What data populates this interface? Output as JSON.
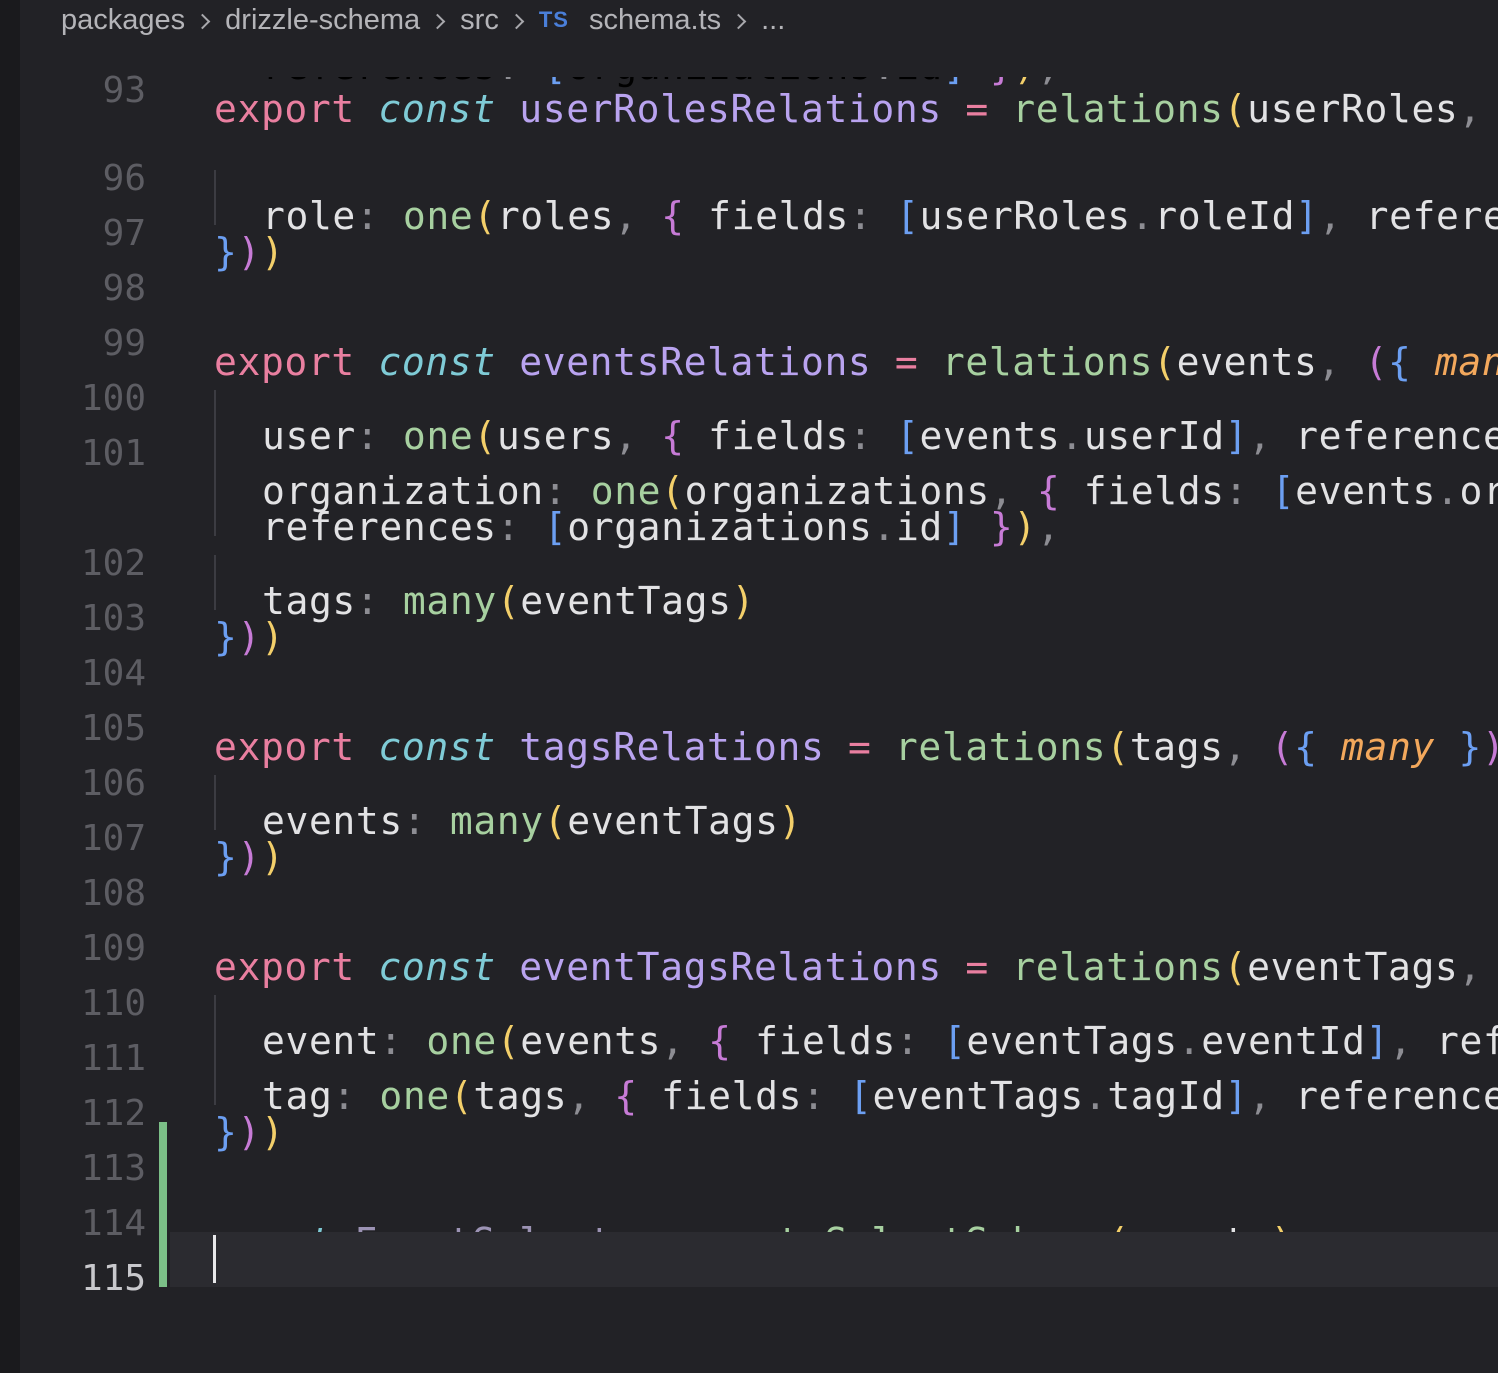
{
  "breadcrumb": {
    "items": [
      "packages",
      "drizzle-schema",
      "src"
    ],
    "file_badge": "TS",
    "file": "schema.ts",
    "ellipsis": "..."
  },
  "editor": {
    "active_line": "115",
    "lines": [
      {
        "num": "93",
        "text": "export const userRolesRelations = relations(userRoles, ({"
      },
      {
        "num": "",
        "text": "references: [organizations.id] }),"
      },
      {
        "num": "96",
        "text": "role: one(roles, { fields: [userRoles.roleId], references: [roles.id] })"
      },
      {
        "num": "97",
        "text": "}))"
      },
      {
        "num": "98",
        "text": ""
      },
      {
        "num": "99",
        "text": "export const eventsRelations = relations(events, ({ many, one }) => ({"
      },
      {
        "num": "100",
        "text": "user: one(users, { fields: [events.userId], references: [users.id] }),"
      },
      {
        "num": "101",
        "text": "organization: one(organizations, { fields: [events.organizationId],"
      },
      {
        "num": "",
        "text": "references: [organizations.id] }),"
      },
      {
        "num": "102",
        "text": "tags: many(eventTags)"
      },
      {
        "num": "103",
        "text": "}))"
      },
      {
        "num": "104",
        "text": ""
      },
      {
        "num": "105",
        "text": "export const tagsRelations = relations(tags, ({ many }) => ({"
      },
      {
        "num": "106",
        "text": "events: many(eventTags)"
      },
      {
        "num": "107",
        "text": "}))"
      },
      {
        "num": "108",
        "text": ""
      },
      {
        "num": "109",
        "text": "export const eventTagsRelations = relations(eventTags, ({ one }) => ({"
      },
      {
        "num": "110",
        "text": "event: one(events, { fields: [eventTags.eventId], references: [events.id] }),"
      },
      {
        "num": "111",
        "text": "tag: one(tags, { fields: [eventTags.tagId], references: [tags.id] })"
      },
      {
        "num": "112",
        "text": "}))"
      },
      {
        "num": "113",
        "text": ""
      },
      {
        "num": "114",
        "text": "const EventSelect = createSelectSchema(events)"
      },
      {
        "num": "115",
        "text": ""
      }
    ]
  },
  "colors": {
    "background": "#222226",
    "keyword": "#e97fa0",
    "storage": "#7fcbd6",
    "variable": "#b9a3ef",
    "function": "#a7d0a0",
    "paren": "#f3cf6a",
    "brace": "#6c9ff2",
    "bracket_nested": "#c77bd6",
    "parameter": "#f3a85c",
    "git_added": "#7bbf87"
  }
}
